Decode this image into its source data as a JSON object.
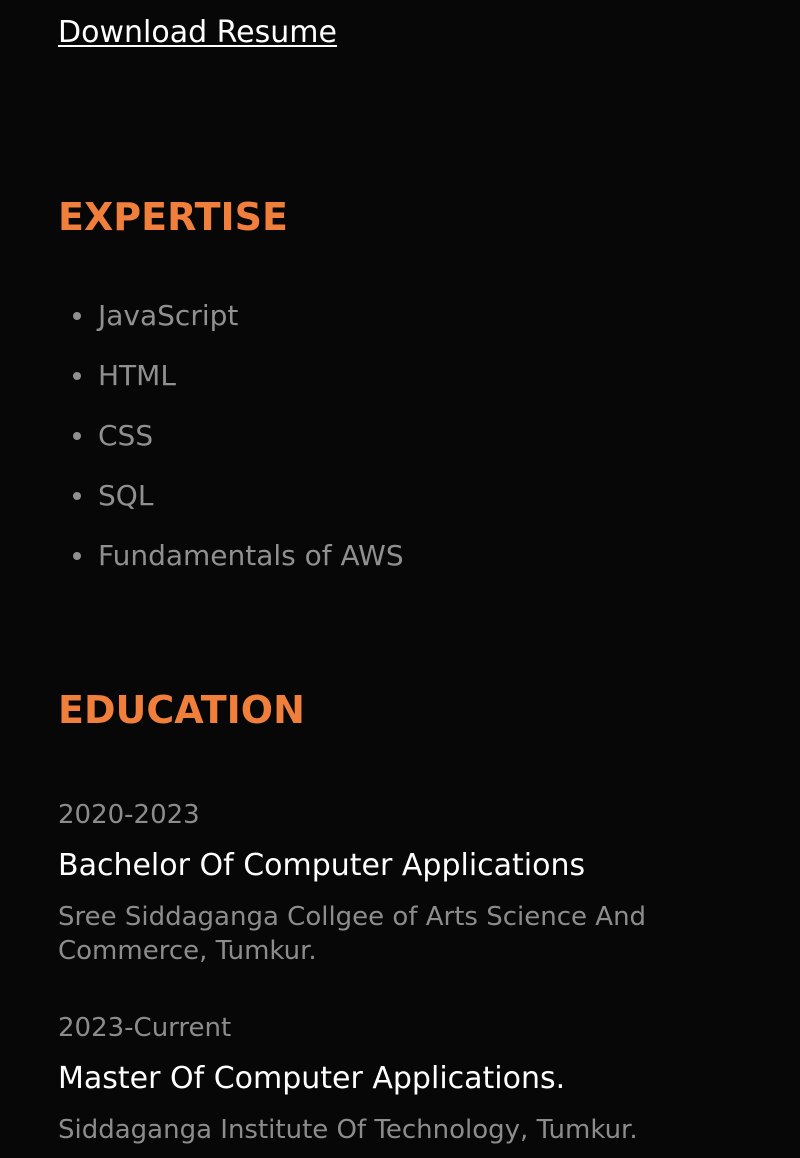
{
  "download": {
    "label": "Download Resume"
  },
  "expertise": {
    "title": "EXPERTISE",
    "items": [
      "JavaScript",
      "HTML",
      "CSS",
      "SQL",
      "Fundamentals of AWS"
    ]
  },
  "education": {
    "title": "EDUCATION",
    "entries": [
      {
        "years": "2020-2023",
        "degree": "Bachelor Of Computer Applications",
        "school": "Sree Siddaganga Collgee of Arts Science And Commerce, Tumkur."
      },
      {
        "years": "2023-Current",
        "degree": "Master Of Computer Applications.",
        "school": "Siddaganga Institute Of Technology, Tumkur."
      }
    ]
  },
  "colors": {
    "background": "#080708",
    "accent": "#f07f3c",
    "muted_text": "#909090",
    "text": "#ffffff"
  }
}
